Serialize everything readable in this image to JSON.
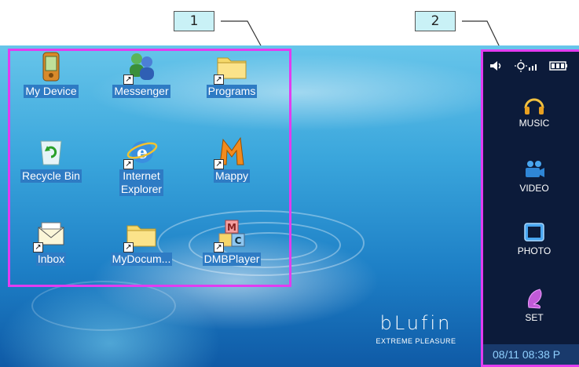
{
  "callouts": {
    "first": "1",
    "second": "2"
  },
  "desktop": {
    "icons": [
      {
        "label": "My Device",
        "icon": "device-icon"
      },
      {
        "label": "Messenger",
        "icon": "messenger-icon"
      },
      {
        "label": "Programs",
        "icon": "folder-icon"
      },
      {
        "label": "Recycle Bin",
        "icon": "recycle-bin-icon"
      },
      {
        "label": "Internet Explorer",
        "label_line1": "Internet",
        "label_line2": "Explorer",
        "icon": "internet-explorer-icon"
      },
      {
        "label": "Mappy",
        "icon": "mappy-icon"
      },
      {
        "label": "Inbox",
        "icon": "inbox-icon"
      },
      {
        "label": "MyDocum...",
        "icon": "folder-icon"
      },
      {
        "label": "DMBPlayer",
        "icon": "dmb-player-icon"
      }
    ],
    "brand": {
      "name": "bLufin",
      "tagline": "EXTREME PLEASURE"
    }
  },
  "sidebar": {
    "status_icons": [
      "speaker-icon",
      "brightness-icon",
      "battery-icon"
    ],
    "menu": [
      {
        "label": "MUSIC",
        "icon": "headphones-icon"
      },
      {
        "label": "VIDEO",
        "icon": "video-camera-icon"
      },
      {
        "label": "PHOTO",
        "icon": "photo-icon"
      },
      {
        "label": "SET",
        "icon": "settings-icon"
      }
    ],
    "clock": "08/11 08:38 P"
  },
  "colors": {
    "highlight_border": "#e23cf0",
    "label_bg": "#2e7bc4",
    "callout_bg": "#c9f1f6"
  }
}
